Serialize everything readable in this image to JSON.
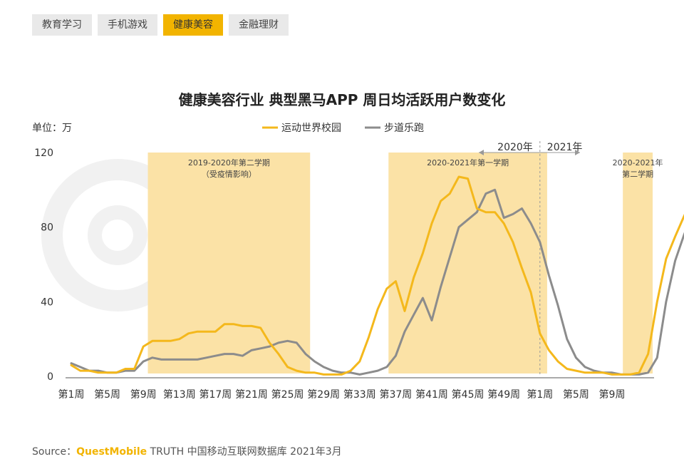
{
  "tabs": [
    {
      "label": "教育学习",
      "active": false
    },
    {
      "label": "手机游戏",
      "active": false
    },
    {
      "label": "健康美容",
      "active": true
    },
    {
      "label": "金融理财",
      "active": false
    }
  ],
  "colors": {
    "accent": "#f2b400",
    "series1": "#f4b81c",
    "series2": "#8c8c8c",
    "band": "#fbe2a6"
  },
  "source": {
    "prefix": "Source：",
    "brand": "QuestMobile",
    "suffix": " TRUTH 中国移动互联网数据库 2021年3月"
  },
  "chart_data": {
    "type": "line",
    "title": "健康美容行业 典型黑马APP 周日均活跃用户数变化",
    "unit_label": "单位：万",
    "ylim": [
      0,
      120
    ],
    "yticks": [
      0,
      40,
      80,
      120
    ],
    "x_tick_labels": [
      "第1周",
      "第5周",
      "第9周",
      "第13周",
      "第17周",
      "第21周",
      "第25周",
      "第29周",
      "第33周",
      "第37周",
      "第41周",
      "第45周",
      "第49周",
      "第1周",
      "第5周",
      "第9周"
    ],
    "x_tick_positions": [
      0,
      4,
      8,
      12,
      16,
      20,
      24,
      28,
      32,
      36,
      40,
      44,
      48,
      52,
      56,
      60
    ],
    "legend_position": "top-center",
    "series": [
      {
        "name": "运动世界校园",
        "values": [
          6,
          3,
          3,
          2,
          2,
          2,
          4,
          4,
          16,
          19,
          19,
          19,
          20,
          23,
          24,
          24,
          24,
          28,
          28,
          27,
          27,
          26,
          18,
          12,
          5,
          3,
          2,
          2,
          1,
          1,
          1,
          3,
          8,
          21,
          36,
          47,
          51,
          35,
          53,
          66,
          82,
          94,
          98,
          107,
          106,
          90,
          88,
          88,
          82,
          72,
          58,
          45,
          23,
          14,
          8,
          4,
          3,
          2,
          2,
          2,
          1,
          1,
          1,
          2,
          12,
          40,
          63,
          75,
          86,
          96
        ]
      },
      {
        "name": "步道乐跑",
        "values": [
          7,
          5,
          3,
          3,
          2,
          2,
          3,
          3,
          8,
          10,
          9,
          9,
          9,
          9,
          9,
          10,
          11,
          12,
          12,
          11,
          14,
          15,
          16,
          18,
          19,
          18,
          12,
          8,
          5,
          3,
          2,
          2,
          1,
          2,
          3,
          5,
          11,
          24,
          33,
          42,
          30,
          48,
          64,
          80,
          84,
          88,
          98,
          100,
          85,
          87,
          90,
          82,
          72,
          54,
          38,
          20,
          10,
          5,
          3,
          2,
          2,
          1,
          1,
          1,
          2,
          10,
          40,
          62,
          76,
          88
        ]
      }
    ],
    "period_bands": [
      {
        "start": 8.5,
        "end": 26.5,
        "label": "2019-2020年第二学期",
        "sublabel": "（受疫情影响）"
      },
      {
        "start": 35.2,
        "end": 52.8,
        "label": "2020-2021年第一学期",
        "sublabel": ""
      },
      {
        "start": 61.2,
        "end": 66.0,
        "label": "2020-2021年",
        "sublabel": "第二学期"
      }
    ],
    "year_divider": {
      "x": 52,
      "left_label": "2020年",
      "right_label": "2021年"
    }
  }
}
